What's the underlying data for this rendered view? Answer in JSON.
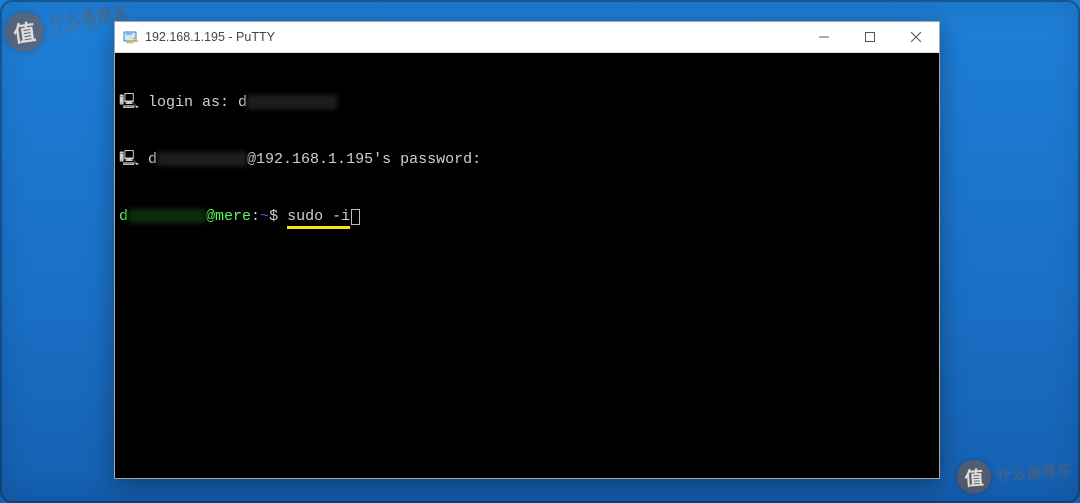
{
  "watermark": {
    "badge": "值",
    "cn": "什么值得买",
    "en": "Lifeisgood"
  },
  "window": {
    "title": "192.168.1.195 - PuTTY"
  },
  "terminal": {
    "line1_icon": "🖳",
    "line1_prefix": "login as: ",
    "line1_user_first": "d",
    "line2_icon": "🖳",
    "line2_user_first": "d",
    "line2_at_host": "@192.168.1.195's password:",
    "line3_user_first": "d",
    "line3_host": "@mere",
    "line3_sep1": ":",
    "line3_path": "~",
    "line3_sep2": "$ ",
    "line3_cmd": "sudo -i"
  }
}
